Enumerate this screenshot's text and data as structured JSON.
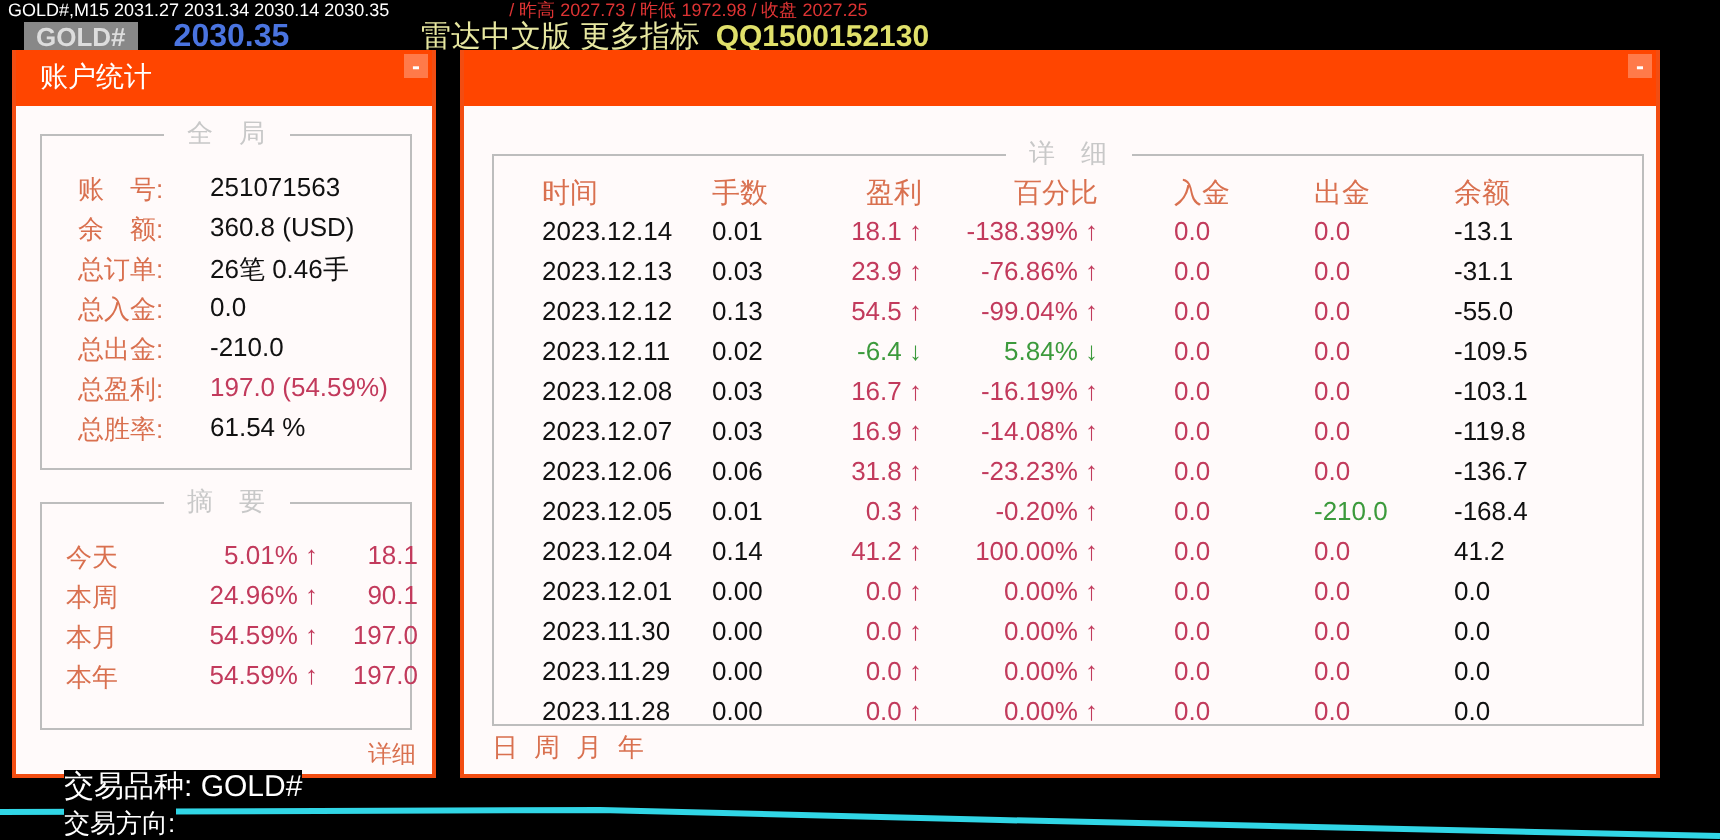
{
  "chart": {
    "ticker": "GOLD#,M15  2031.27 2031.34 2030.14 2030.35",
    "prev_day": "/ 昨高 2027.73 / 昨低 1972.98 / 收盘 2027.25",
    "symbol_badge": "GOLD#",
    "price": "2030.35",
    "banner": "雷达中文版 更多指标",
    "banner_qq": "QQ1500152130",
    "symbol_label": "交易品种: GOLD#",
    "direction_label": "交易方向:"
  },
  "account_panel": {
    "title": "账户统计",
    "minimize": "-",
    "overall": {
      "legend": "全　局",
      "rows": [
        {
          "label": "账　号:",
          "value": "251071563",
          "highlight": false
        },
        {
          "label": "余　额:",
          "value": "360.8 (USD)",
          "highlight": false
        },
        {
          "label": "总订单:",
          "value": "26笔 0.46手",
          "highlight": false
        },
        {
          "label": "总入金:",
          "value": "0.0",
          "highlight": false
        },
        {
          "label": "总出金:",
          "value": "-210.0",
          "highlight": false
        },
        {
          "label": "总盈利:",
          "value": "197.0 (54.59%)",
          "highlight": true
        },
        {
          "label": "总胜率:",
          "value": "61.54 %",
          "highlight": false
        }
      ]
    },
    "summary": {
      "legend": "摘　要",
      "rows": [
        {
          "label": "今天",
          "percent": "5.01% ↑",
          "amount": "18.1"
        },
        {
          "label": "本周",
          "percent": "24.96% ↑",
          "amount": "90.1"
        },
        {
          "label": "本月",
          "percent": "54.59% ↑",
          "amount": "197.0"
        },
        {
          "label": "本年",
          "percent": "54.59% ↑",
          "amount": "197.0"
        }
      ]
    },
    "details_link": "详细"
  },
  "detail_panel": {
    "minimize": "-",
    "legend": "详　细",
    "columns": [
      "时间",
      "手数",
      "盈利",
      "百分比",
      "入金",
      "出金",
      "余额"
    ],
    "rows": [
      {
        "date": "2023.12.14",
        "lots": "0.01",
        "profit": "18.1 ↑",
        "percent": "-138.39% ↑",
        "profit_up": true,
        "deposit": "0.0",
        "withdraw": "0.0",
        "withdraw_nonzero": false,
        "balance": "-13.1"
      },
      {
        "date": "2023.12.13",
        "lots": "0.03",
        "profit": "23.9 ↑",
        "percent": "-76.86% ↑",
        "profit_up": true,
        "deposit": "0.0",
        "withdraw": "0.0",
        "withdraw_nonzero": false,
        "balance": "-31.1"
      },
      {
        "date": "2023.12.12",
        "lots": "0.13",
        "profit": "54.5 ↑",
        "percent": "-99.04% ↑",
        "profit_up": true,
        "deposit": "0.0",
        "withdraw": "0.0",
        "withdraw_nonzero": false,
        "balance": "-55.0"
      },
      {
        "date": "2023.12.11",
        "lots": "0.02",
        "profit": "-6.4 ↓",
        "percent": "5.84% ↓",
        "profit_up": false,
        "deposit": "0.0",
        "withdraw": "0.0",
        "withdraw_nonzero": false,
        "balance": "-109.5"
      },
      {
        "date": "2023.12.08",
        "lots": "0.03",
        "profit": "16.7 ↑",
        "percent": "-16.19% ↑",
        "profit_up": true,
        "deposit": "0.0",
        "withdraw": "0.0",
        "withdraw_nonzero": false,
        "balance": "-103.1"
      },
      {
        "date": "2023.12.07",
        "lots": "0.03",
        "profit": "16.9 ↑",
        "percent": "-14.08% ↑",
        "profit_up": true,
        "deposit": "0.0",
        "withdraw": "0.0",
        "withdraw_nonzero": false,
        "balance": "-119.8"
      },
      {
        "date": "2023.12.06",
        "lots": "0.06",
        "profit": "31.8 ↑",
        "percent": "-23.23% ↑",
        "profit_up": true,
        "deposit": "0.0",
        "withdraw": "0.0",
        "withdraw_nonzero": false,
        "balance": "-136.7"
      },
      {
        "date": "2023.12.05",
        "lots": "0.01",
        "profit": "0.3 ↑",
        "percent": "-0.20% ↑",
        "profit_up": true,
        "deposit": "0.0",
        "withdraw": "-210.0",
        "withdraw_nonzero": true,
        "balance": "-168.4"
      },
      {
        "date": "2023.12.04",
        "lots": "0.14",
        "profit": "41.2 ↑",
        "percent": "100.00% ↑",
        "profit_up": true,
        "deposit": "0.0",
        "withdraw": "0.0",
        "withdraw_nonzero": false,
        "balance": "41.2"
      },
      {
        "date": "2023.12.01",
        "lots": "0.00",
        "profit": "0.0 ↑",
        "percent": "0.00% ↑",
        "profit_up": true,
        "deposit": "0.0",
        "withdraw": "0.0",
        "withdraw_nonzero": false,
        "balance": "0.0"
      },
      {
        "date": "2023.11.30",
        "lots": "0.00",
        "profit": "0.0 ↑",
        "percent": "0.00% ↑",
        "profit_up": true,
        "deposit": "0.0",
        "withdraw": "0.0",
        "withdraw_nonzero": false,
        "balance": "0.0"
      },
      {
        "date": "2023.11.29",
        "lots": "0.00",
        "profit": "0.0 ↑",
        "percent": "0.00% ↑",
        "profit_up": true,
        "deposit": "0.0",
        "withdraw": "0.0",
        "withdraw_nonzero": false,
        "balance": "0.0"
      },
      {
        "date": "2023.11.28",
        "lots": "0.00",
        "profit": "0.0 ↑",
        "percent": "0.00% ↑",
        "profit_up": true,
        "deposit": "0.0",
        "withdraw": "0.0",
        "withdraw_nonzero": false,
        "balance": "0.0"
      }
    ],
    "periods": [
      "日",
      "周",
      "月",
      "年"
    ]
  }
}
